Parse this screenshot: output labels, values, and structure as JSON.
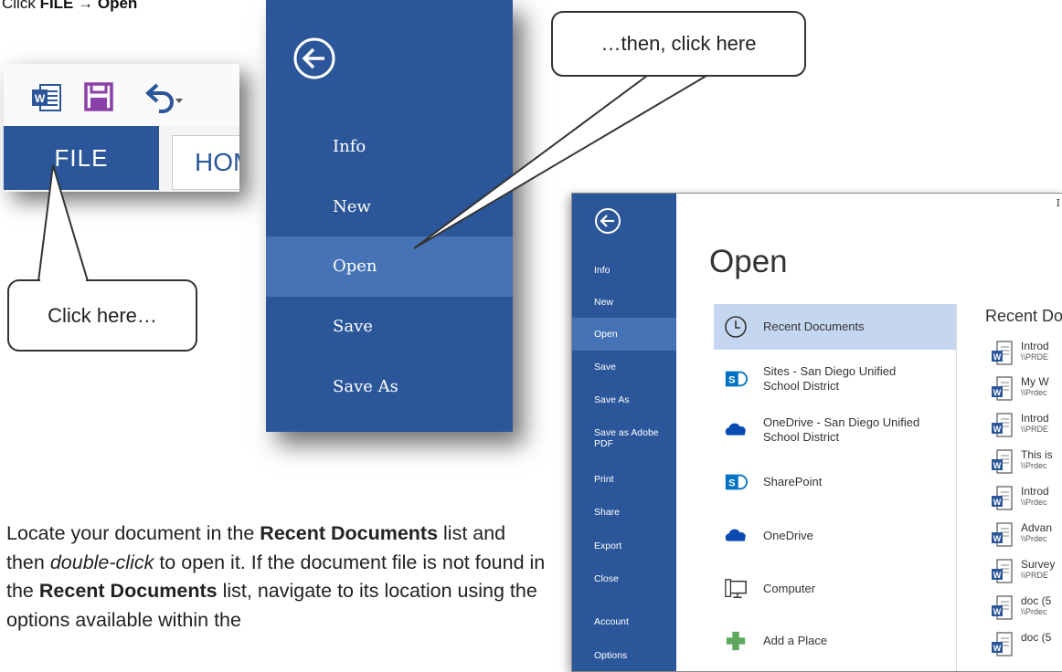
{
  "instruction": {
    "prefix": "Click ",
    "file": "FILE",
    "arrow": "→",
    "open": "Open"
  },
  "ribbon": {
    "file_tab": "FILE",
    "home_tab": "HOME"
  },
  "backstage_menu": {
    "items": [
      {
        "label": "Info"
      },
      {
        "label": "New"
      },
      {
        "label": "Open",
        "active": true
      },
      {
        "label": "Save"
      },
      {
        "label": "Save As"
      }
    ]
  },
  "callouts": {
    "then_click": "…then, click here",
    "click_here": "Click here…"
  },
  "paragraph": {
    "p1": "Locate your document in the ",
    "b1": "Recent Documents",
    "p2": " list and then ",
    "i1": "double-click",
    "p3": " to open it. If the document file is not found in the ",
    "b2": "Recent Documents",
    "p4": " list, navigate to its location using the options available within the"
  },
  "open_screen": {
    "corner_label": "I",
    "title": "Open",
    "sidebar": [
      {
        "label": "Info"
      },
      {
        "label": "New"
      },
      {
        "label": "Open",
        "active": true
      },
      {
        "label": "Save"
      },
      {
        "label": "Save As"
      },
      {
        "label": "Save as Adobe PDF"
      },
      {
        "label": "Print"
      },
      {
        "label": "Share"
      },
      {
        "label": "Export"
      },
      {
        "label": "Close"
      },
      {
        "label": "Account"
      },
      {
        "label": "Options"
      }
    ],
    "places": [
      {
        "label": "Recent Documents",
        "icon": "clock-icon",
        "active": true
      },
      {
        "label": "Sites - San Diego Unified School District",
        "icon": "sharepoint-icon"
      },
      {
        "label": "OneDrive - San Diego Unified School District",
        "icon": "onedrive-icon"
      },
      {
        "label": "SharePoint",
        "icon": "sharepoint-icon"
      },
      {
        "label": "OneDrive",
        "icon": "onedrive-icon"
      },
      {
        "label": "Computer",
        "icon": "computer-icon"
      },
      {
        "label": "Add a Place",
        "icon": "plus-icon"
      }
    ],
    "recent_heading": "Recent Do",
    "recent_docs": [
      {
        "name": "Introd",
        "path": "\\\\PRDE"
      },
      {
        "name": "My W",
        "path": "\\\\Prdec"
      },
      {
        "name": "Introd",
        "path": "\\\\PRDE"
      },
      {
        "name": "This is",
        "path": "\\\\Prdec"
      },
      {
        "name": "Introd",
        "path": "\\\\Prdec"
      },
      {
        "name": "Advan",
        "path": "\\\\Prdec"
      },
      {
        "name": "Survey",
        "path": "\\\\PRDE"
      },
      {
        "name": "doc (5",
        "path": "\\\\Prdec"
      },
      {
        "name": "doc (5",
        "path": ""
      }
    ]
  },
  "colors": {
    "word_blue": "#2b579a",
    "active_blue": "#4673b6",
    "selected_place": "#c5d7f0"
  }
}
